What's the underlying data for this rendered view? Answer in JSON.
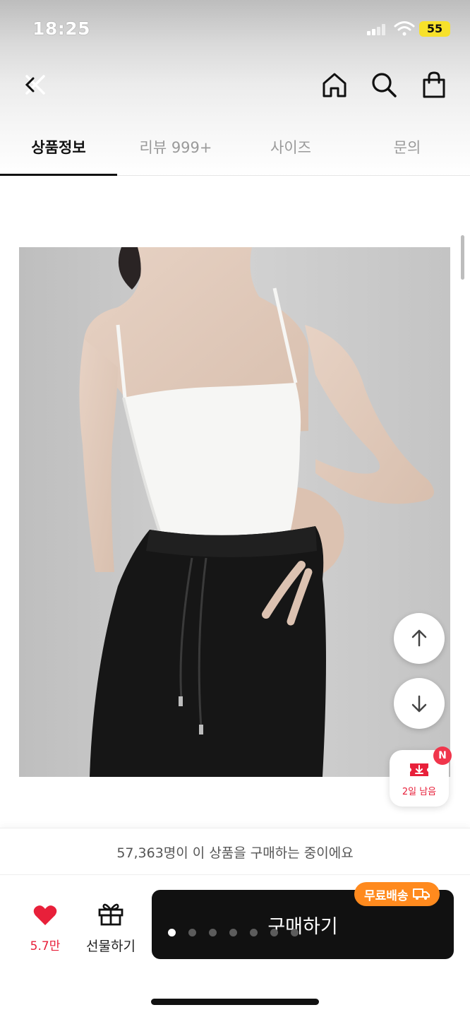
{
  "status_bar": {
    "time": "18:25",
    "battery": "55"
  },
  "nav": {
    "icons": [
      "close-icon",
      "home-icon",
      "search-icon",
      "shopping-bag-icon"
    ]
  },
  "tabs": [
    {
      "label": "상품정보",
      "active": true
    },
    {
      "label": "리뷰 999+",
      "active": false
    },
    {
      "label": "사이즈",
      "active": false
    },
    {
      "label": "문의",
      "active": false
    }
  ],
  "product_image": {
    "subject": "white-camisole-black-pants"
  },
  "floating": {
    "scroll_up_icon": "arrow-up-icon",
    "scroll_down_icon": "arrow-down-icon",
    "coupon": {
      "badge": "N",
      "label": "2일 남음",
      "icon": "coupon-download-icon"
    }
  },
  "notice": {
    "text": "57,363명이 이 상품을 구매하는 중이에요"
  },
  "bottom_bar": {
    "like": {
      "count": "5.7만",
      "icon": "heart-icon",
      "color": "#e8203a"
    },
    "gift": {
      "label": "선물하기",
      "icon": "gift-icon"
    },
    "buy": {
      "label": "구매하기",
      "free_shipping": "무료배송",
      "badge_color": "#ff8a1e"
    },
    "carousel": {
      "count": 7,
      "active_index": 0
    }
  }
}
